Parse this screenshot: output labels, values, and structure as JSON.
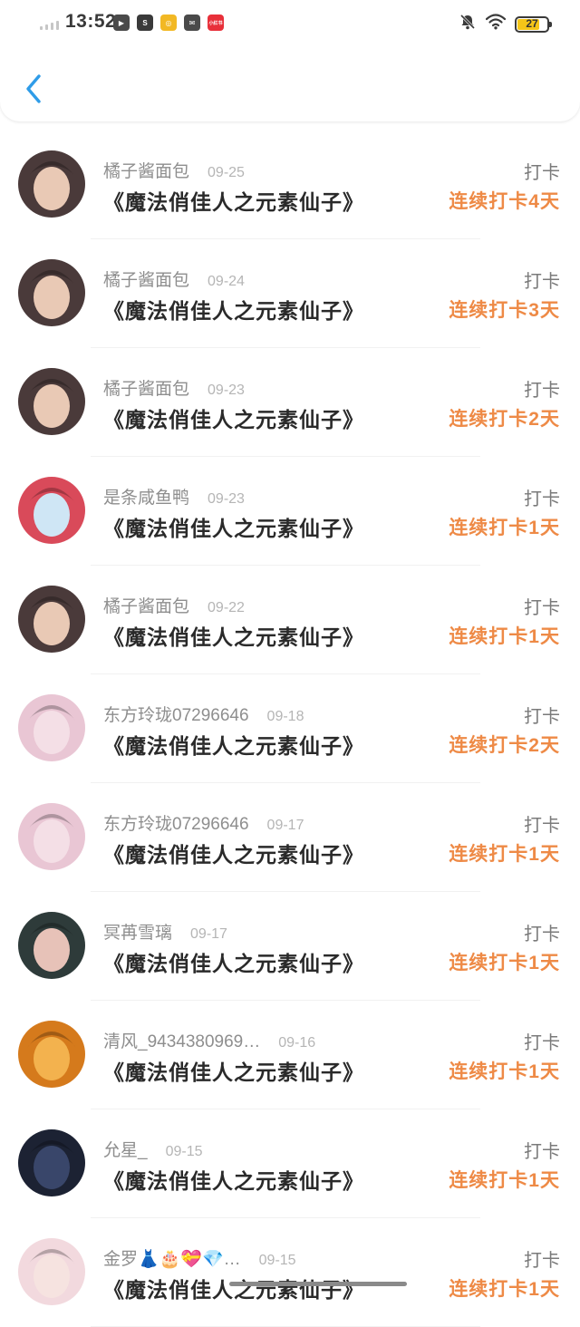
{
  "status_bar": {
    "time": "13:52",
    "battery": "27",
    "app_icons": [
      {
        "name": "video-app-icon",
        "color": "#4a4a4a",
        "glyph": "▶"
      },
      {
        "name": "browser-app-icon",
        "color": "#3a3a3a",
        "glyph": "S"
      },
      {
        "name": "coin-app-icon",
        "color": "#f2b824",
        "glyph": "◎"
      },
      {
        "name": "mail-app-icon",
        "color": "#4a4a4a",
        "glyph": "✉"
      },
      {
        "name": "red-app-icon",
        "color": "#e8303a",
        "glyph": "小红书"
      }
    ]
  },
  "entries": [
    {
      "user": "橘子酱面包",
      "date": "09-25",
      "book": "《魔法俏佳人之元素仙子》",
      "tag": "打卡",
      "streak": "连续打卡4天",
      "avatar": {
        "bg": "#4a3a3a",
        "face": "#e9c9b5"
      }
    },
    {
      "user": "橘子酱面包",
      "date": "09-24",
      "book": "《魔法俏佳人之元素仙子》",
      "tag": "打卡",
      "streak": "连续打卡3天",
      "avatar": {
        "bg": "#4a3a3a",
        "face": "#e9c9b5"
      }
    },
    {
      "user": "橘子酱面包",
      "date": "09-23",
      "book": "《魔法俏佳人之元素仙子》",
      "tag": "打卡",
      "streak": "连续打卡2天",
      "avatar": {
        "bg": "#4a3a3a",
        "face": "#e9c9b5"
      }
    },
    {
      "user": "是条咸鱼鸭",
      "date": "09-23",
      "book": "《魔法俏佳人之元素仙子》",
      "tag": "打卡",
      "streak": "连续打卡1天",
      "avatar": {
        "bg": "#d94a5a",
        "face": "#cfe6f5"
      }
    },
    {
      "user": "橘子酱面包",
      "date": "09-22",
      "book": "《魔法俏佳人之元素仙子》",
      "tag": "打卡",
      "streak": "连续打卡1天",
      "avatar": {
        "bg": "#4a3a3a",
        "face": "#e9c9b5"
      }
    },
    {
      "user": "东方玲珑07296646",
      "date": "09-18",
      "book": "《魔法俏佳人之元素仙子》",
      "tag": "打卡",
      "streak": "连续打卡2天",
      "avatar": {
        "bg": "#e9c6d4",
        "face": "#f4dfe6"
      }
    },
    {
      "user": "东方玲珑07296646",
      "date": "09-17",
      "book": "《魔法俏佳人之元素仙子》",
      "tag": "打卡",
      "streak": "连续打卡1天",
      "avatar": {
        "bg": "#e9c6d4",
        "face": "#f4dfe6"
      }
    },
    {
      "user": "冥苒雪璃",
      "date": "09-17",
      "book": "《魔法俏佳人之元素仙子》",
      "tag": "打卡",
      "streak": "连续打卡1天",
      "avatar": {
        "bg": "#2e3b3a",
        "face": "#e7c2b8"
      }
    },
    {
      "user": "清风_9434380969…",
      "date": "09-16",
      "book": "《魔法俏佳人之元素仙子》",
      "tag": "打卡",
      "streak": "连续打卡1天",
      "avatar": {
        "bg": "#d57a1c",
        "face": "#f3b24e"
      }
    },
    {
      "user": "允星_",
      "date": "09-15",
      "book": "《魔法俏佳人之元素仙子》",
      "tag": "打卡",
      "streak": "连续打卡1天",
      "avatar": {
        "bg": "#1c2233",
        "face": "#39466a"
      }
    },
    {
      "user": "金罗👗🎂💝💎…",
      "date": "09-15",
      "book": "《魔法俏佳人之元素仙子》",
      "tag": "打卡",
      "streak": "连续打卡1天",
      "avatar": {
        "bg": "#f2d9de",
        "face": "#f6e3e0"
      }
    }
  ]
}
